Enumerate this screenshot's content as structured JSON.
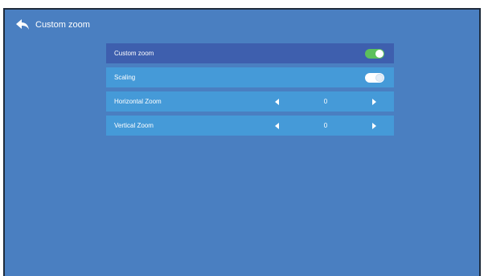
{
  "header": {
    "title": "Custom zoom",
    "back_icon": "back-arrow-icon"
  },
  "menu": {
    "items": [
      {
        "label": "Custom zoom",
        "control": "toggle",
        "state": "on",
        "selected": true
      },
      {
        "label": "Scaling",
        "control": "toggle",
        "state": "off",
        "selected": false
      },
      {
        "label": "Horizontal Zoom",
        "control": "stepper",
        "value": "0",
        "selected": false
      },
      {
        "label": "Vertical Zoom",
        "control": "stepper",
        "value": "0",
        "selected": false
      }
    ]
  },
  "colors": {
    "background": "#4a7fc1",
    "row": "#459ad8",
    "selected_row": "#3e5fae",
    "toggle_on": "#5cc05c"
  }
}
